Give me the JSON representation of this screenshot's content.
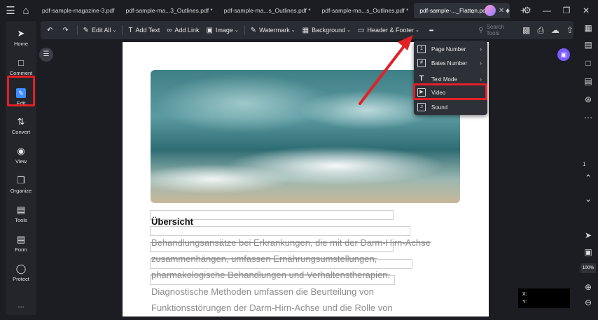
{
  "tabs": [
    {
      "label": "pdf-sample-magazine-3.pdf"
    },
    {
      "label": "pdf-sample-ma...3_Outlines.pdf *"
    },
    {
      "label": "pdf-sample-ma...s_Outlines.pdf *"
    },
    {
      "label": "pdf-sample-ma...s_Outlines.pdf *"
    },
    {
      "label": "pdf-sample-..._Flatten.pdf *"
    }
  ],
  "sidebar": {
    "items": [
      {
        "label": "Home"
      },
      {
        "label": "Comment"
      },
      {
        "label": "Edit"
      },
      {
        "label": "Convert"
      },
      {
        "label": "View"
      },
      {
        "label": "Organize"
      },
      {
        "label": "Tools"
      },
      {
        "label": "Form"
      },
      {
        "label": "Protect"
      },
      {
        "label": "..."
      }
    ]
  },
  "toolbar": {
    "edit_all": "Edit All",
    "add_text": "Add Text",
    "add_link": "Add Link",
    "image": "Image",
    "watermark": "Watermark",
    "background": "Background",
    "header_footer": "Header & Footer",
    "more": "•••",
    "search_placeholder": "Search Tools"
  },
  "menu": {
    "items": [
      {
        "label": "Page Number"
      },
      {
        "label": "Bates Number"
      },
      {
        "label": "Text Mode"
      },
      {
        "label": "Video"
      },
      {
        "label": "Sound"
      }
    ]
  },
  "document": {
    "heading": "Übersicht",
    "lines": [
      "Behandlungsansätze bei Erkrankungen, die mit der Darm-Hirn-Achse",
      "zusammenhängen, umfassen Ernährungsumstellungen,",
      "pharmakologische Behandlungen und Verhaltenstherapien.",
      "Diagnostische Methoden umfassen die Beurteilung von",
      "Funktionsstörungen der Darm-Hirn-Achse und die Rolle von"
    ]
  },
  "right_rail": {
    "page_number": "1",
    "zoom": "100%"
  },
  "coords": {
    "x_label": "X:",
    "y_label": "Y:"
  },
  "colors": {
    "highlight": "#e32026",
    "accent": "#3f8cff"
  }
}
